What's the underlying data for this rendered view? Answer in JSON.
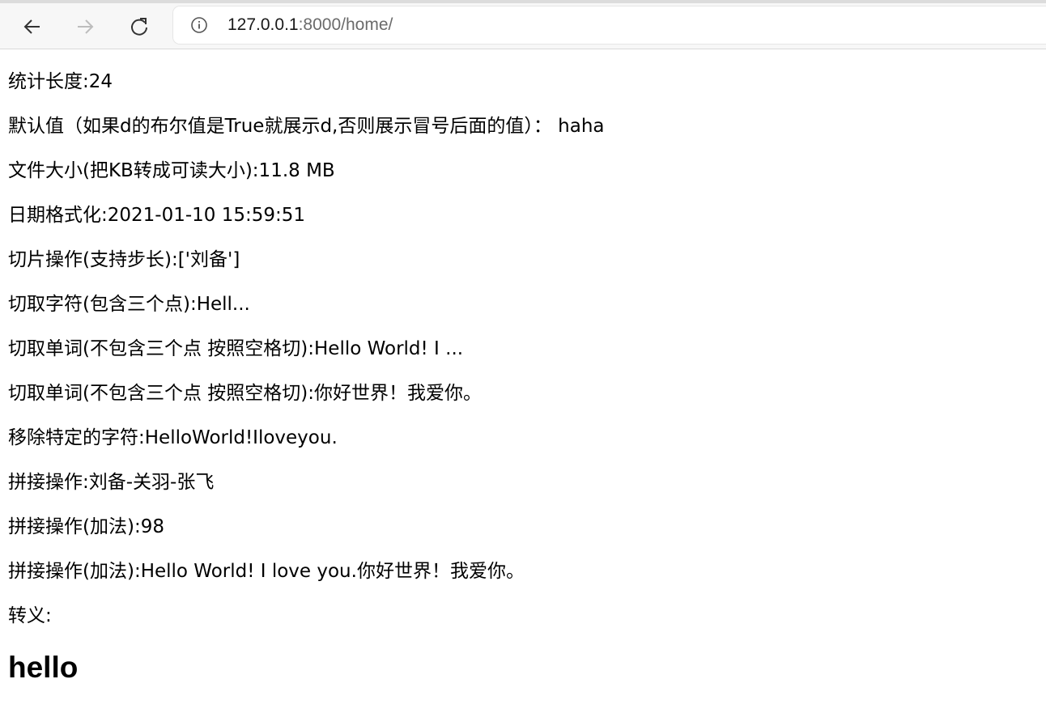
{
  "browser": {
    "url_host": "127.0.0.1",
    "url_rest": ":8000/home/",
    "icons": {
      "back": "back-arrow-icon",
      "forward": "forward-arrow-icon",
      "reload": "reload-icon",
      "info": "info-icon"
    }
  },
  "page": {
    "lines": [
      "统计长度:24",
      "默认值（如果d的布尔值是True就展示d,否则展示冒号后面的值）： haha",
      "文件大小(把KB转成可读大小):11.8 MB",
      "日期格式化:2021-01-10 15:59:51",
      "切片操作(支持步长):['刘备']",
      "切取字符(包含三个点):Hell...",
      "切取单词(不包含三个点 按照空格切):Hello World! I ...",
      "切取单词(不包含三个点 按照空格切):你好世界！我爱你。",
      "移除特定的字符:HelloWorld!Iloveyou.",
      "拼接操作:刘备-关羽-张飞",
      "拼接操作(加法):98",
      "拼接操作(加法):Hello World! I love you.你好世界！我爱你。",
      "转义:"
    ],
    "heading": "hello"
  }
}
